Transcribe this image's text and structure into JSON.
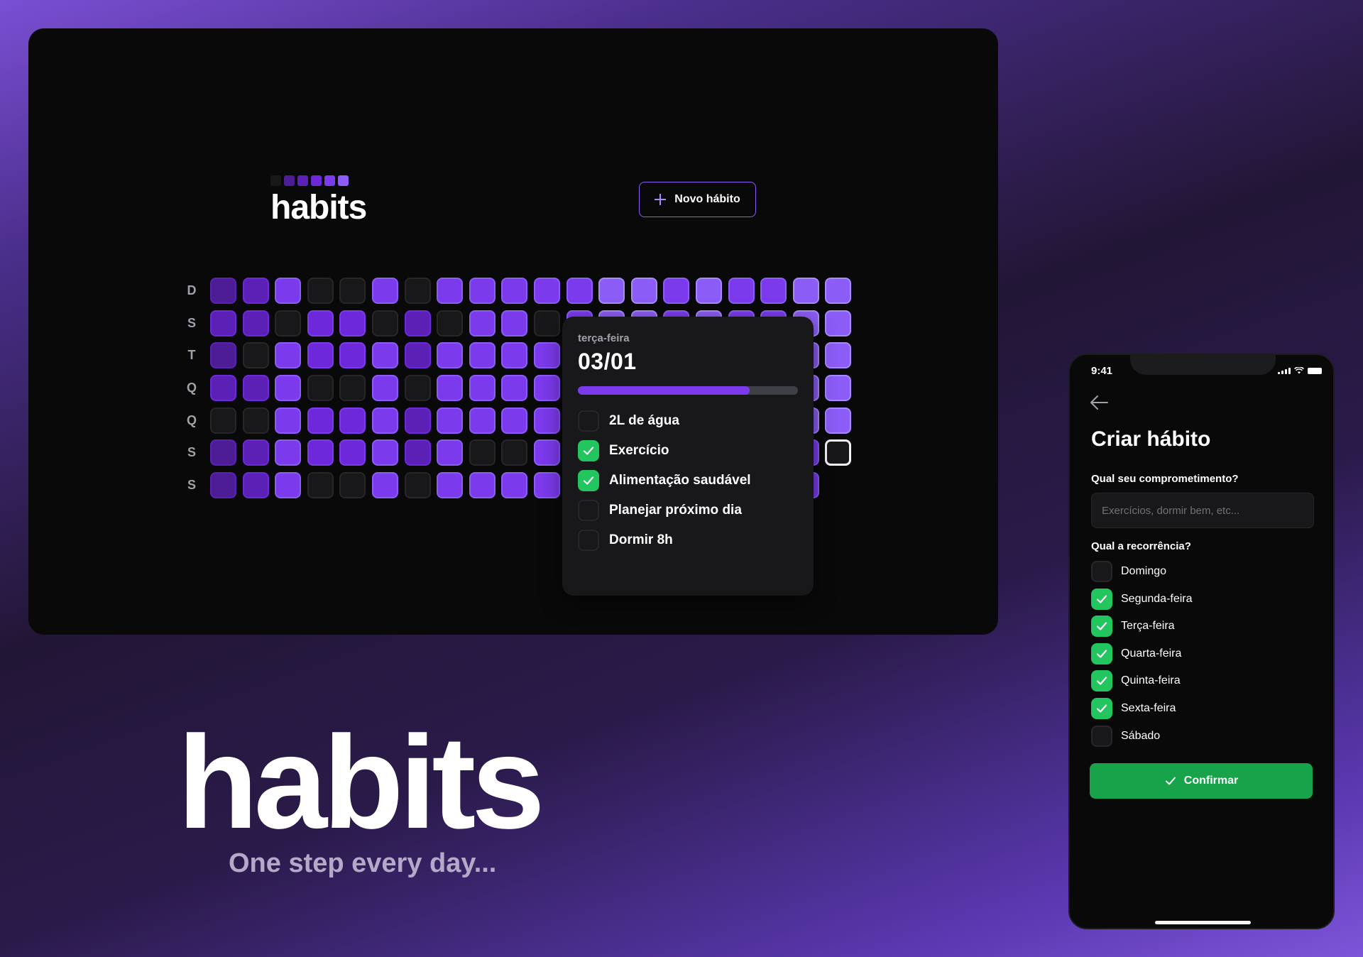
{
  "desktop": {
    "title": "habits",
    "new_habit_label": "Novo hábito",
    "logo_levels": [
      0,
      1,
      2,
      3,
      4,
      5
    ],
    "weekdays": [
      "D",
      "S",
      "T",
      "Q",
      "Q",
      "S",
      "S"
    ],
    "grid_columns": [
      [
        1,
        2,
        1,
        2,
        0,
        1,
        1
      ],
      [
        2,
        2,
        0,
        2,
        0,
        2,
        2
      ],
      [
        4,
        0,
        4,
        4,
        4,
        4,
        4
      ],
      [
        0,
        3,
        3,
        0,
        3,
        3,
        0
      ],
      [
        0,
        3,
        3,
        0,
        3,
        3,
        0
      ],
      [
        4,
        0,
        4,
        4,
        4,
        4,
        4
      ],
      [
        0,
        2,
        2,
        0,
        2,
        2,
        0
      ],
      [
        4,
        0,
        4,
        4,
        4,
        4,
        4
      ],
      [
        4,
        4,
        4,
        4,
        4,
        0,
        4
      ],
      [
        4,
        4,
        4,
        4,
        4,
        0,
        4
      ],
      [
        4,
        0,
        4,
        4,
        4,
        4,
        4
      ],
      [
        4,
        4,
        4,
        4,
        4,
        4,
        4
      ],
      [
        5,
        5,
        5,
        5,
        5,
        5,
        5
      ],
      [
        5,
        5,
        5,
        5,
        5,
        5,
        5
      ],
      [
        4,
        4,
        4,
        4,
        4,
        4,
        4
      ],
      [
        5,
        5,
        5,
        5,
        5,
        5,
        5
      ],
      [
        4,
        4,
        4,
        4,
        4,
        4,
        4
      ],
      [
        4,
        4,
        4,
        4,
        4,
        4,
        4
      ],
      [
        5,
        5,
        5,
        5,
        5,
        4,
        4
      ],
      [
        5,
        5,
        5,
        5,
        5,
        6,
        -1
      ]
    ],
    "popover": {
      "weekday": "terça-feira",
      "date": "03/01",
      "progress": 0.78,
      "habits": [
        {
          "label": "2L de água",
          "checked": false
        },
        {
          "label": "Exercício",
          "checked": true
        },
        {
          "label": "Alimentação saudável",
          "checked": true
        },
        {
          "label": "Planejar próximo dia",
          "checked": false
        },
        {
          "label": "Dormir 8h",
          "checked": false
        }
      ]
    }
  },
  "brand": {
    "title": "habits",
    "tagline": "One step every day..."
  },
  "phone": {
    "time": "9:41",
    "title": "Criar hábito",
    "commitment_label": "Qual seu comprometimento?",
    "commitment_placeholder": "Exercícios, dormir bem, etc...",
    "recurrence_label": "Qual a recorrência?",
    "days": [
      {
        "label": "Domingo",
        "checked": false
      },
      {
        "label": "Segunda-feira",
        "checked": true
      },
      {
        "label": "Terça-feira",
        "checked": true
      },
      {
        "label": "Quarta-feira",
        "checked": true
      },
      {
        "label": "Quinta-feira",
        "checked": true
      },
      {
        "label": "Sexta-feira",
        "checked": true
      },
      {
        "label": "Sábado",
        "checked": false
      }
    ],
    "confirm_label": "Confirmar"
  },
  "colors": {
    "accent": "#8b5cf6",
    "success": "#22c55e",
    "confirm": "#16a34a",
    "surface": "#18181b"
  }
}
